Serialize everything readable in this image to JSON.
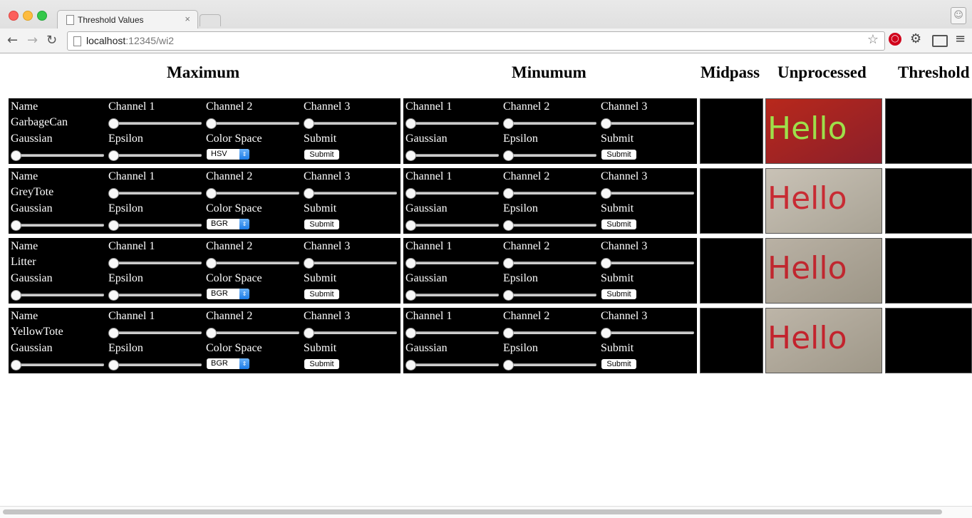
{
  "browser": {
    "tab_title": "Threshold Values",
    "tab_close": "×",
    "url_host": "localhost",
    "url_rest": ":12345/wi2",
    "icons": [
      "page-icon",
      "back-arrow-icon",
      "forward-arrow-icon",
      "reload-icon",
      "star-icon",
      "stop-extension-icon",
      "gear-icon",
      "cast-icon",
      "menu-icon",
      "profile-icon"
    ]
  },
  "headers": {
    "maximum": "Maximum",
    "minimum": "Minumum",
    "midpass": "Midpass",
    "unprocessed": "Unprocessed",
    "threshold": "Threshold"
  },
  "labels": {
    "name": "Name",
    "channel1": "Channel 1",
    "channel2": "Channel 2",
    "channel3": "Channel 3",
    "gaussian": "Gaussian",
    "epsilon": "Epsilon",
    "color_space": "Color Space",
    "submit_label": "Submit",
    "submit_button": "Submit"
  },
  "image_text": "Hello",
  "rows": [
    {
      "name": "GarbageCan",
      "color_space": "HSV",
      "image": {
        "bg_from": "#b8281c",
        "bg_to": "#8a1f2a",
        "text_color": "#9ee04a"
      },
      "max": {
        "channel1": 0,
        "channel2": 0,
        "channel3": 0,
        "gaussian": 0,
        "epsilon": 0
      },
      "min": {
        "channel1": 0,
        "channel2": 0,
        "channel3": 0,
        "gaussian": 0,
        "epsilon": 0
      }
    },
    {
      "name": "GreyTote",
      "color_space": "BGR",
      "image": {
        "bg_from": "#c9c2b6",
        "bg_to": "#a8a294",
        "text_color": "#c82b33"
      },
      "max": {
        "channel1": 0,
        "channel2": 0,
        "channel3": 0,
        "gaussian": 0,
        "epsilon": 0
      },
      "min": {
        "channel1": 0,
        "channel2": 0,
        "channel3": 0,
        "gaussian": 0,
        "epsilon": 0
      }
    },
    {
      "name": "Litter",
      "color_space": "BGR",
      "image": {
        "bg_from": "#b9b1a4",
        "bg_to": "#9c9586",
        "text_color": "#c0272f"
      },
      "max": {
        "channel1": 0,
        "channel2": 0,
        "channel3": 0,
        "gaussian": 0,
        "epsilon": 0
      },
      "min": {
        "channel1": 0,
        "channel2": 0,
        "channel3": 0,
        "gaussian": 0,
        "epsilon": 0
      }
    },
    {
      "name": "YellowTote",
      "color_space": "BGR",
      "image": {
        "bg_from": "#bdb5a8",
        "bg_to": "#9e9788",
        "text_color": "#c3232d"
      },
      "max": {
        "channel1": 0,
        "channel2": 0,
        "channel3": 0,
        "gaussian": 0,
        "epsilon": 0
      },
      "min": {
        "channel1": 0,
        "channel2": 0,
        "channel3": 0,
        "gaussian": 0,
        "epsilon": 0
      }
    }
  ]
}
